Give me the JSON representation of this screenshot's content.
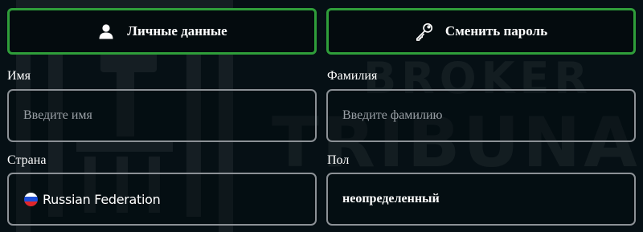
{
  "tabs": {
    "personal_label": "Личные данные",
    "password_label": "Сменить пароль"
  },
  "fields": {
    "first_name": {
      "label": "Имя",
      "placeholder": "Введите имя",
      "value": ""
    },
    "last_name": {
      "label": "Фамилия",
      "placeholder": "Введите фамилию",
      "value": ""
    },
    "country": {
      "label": "Страна",
      "value": "Russian Federation",
      "flag_colors": [
        "#ffffff",
        "#1e4fd8",
        "#e0262b"
      ]
    },
    "gender": {
      "label": "Пол",
      "value": "неопределенный"
    }
  },
  "watermark": {
    "line1": "BROKER",
    "line2": "TRIBUNAL"
  },
  "colors": {
    "accent": "#2f9e3a",
    "background": "#061015",
    "field_border": "#8c9196"
  },
  "icons": {
    "personal": "user-icon",
    "password": "key-icon"
  }
}
